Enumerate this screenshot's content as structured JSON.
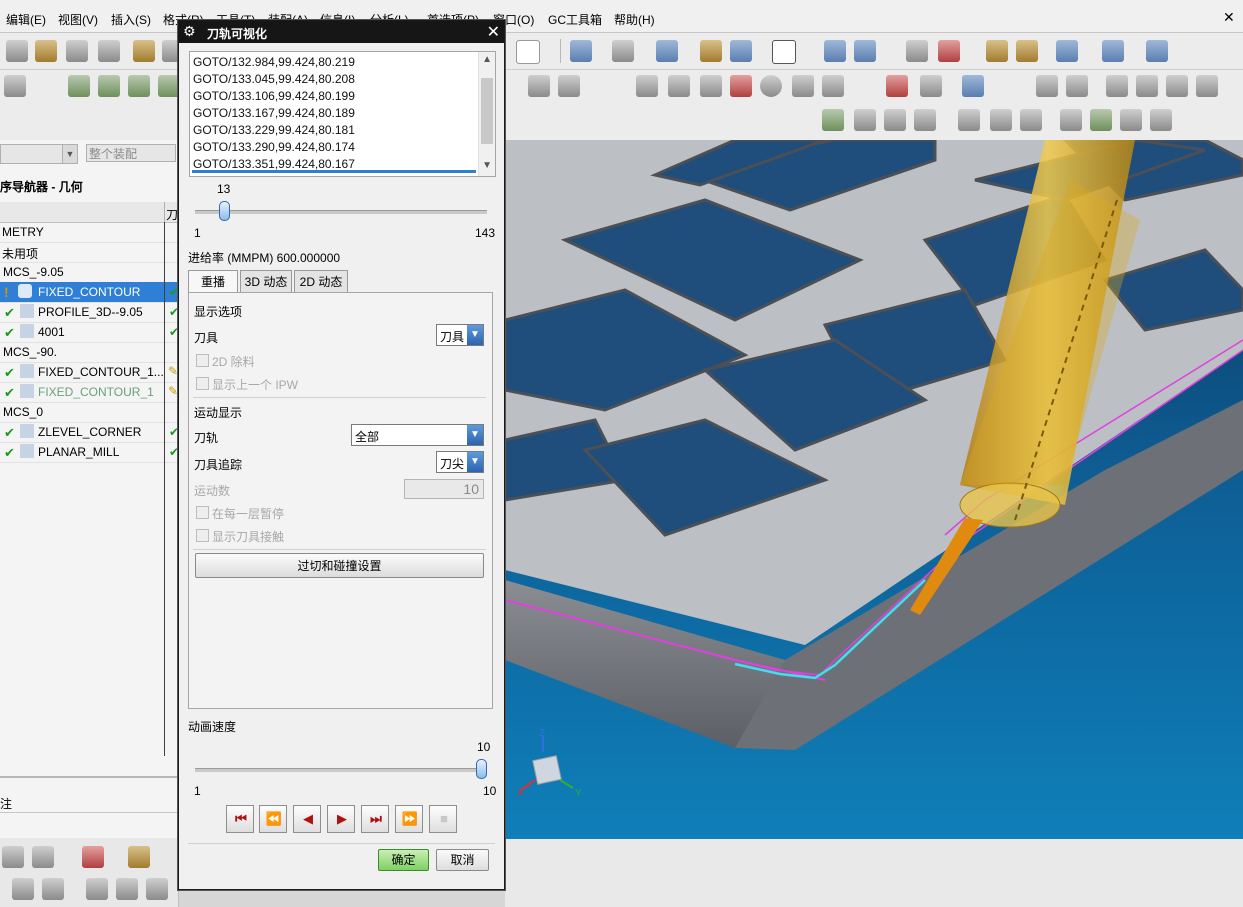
{
  "menubar": {
    "items": [
      "编辑(E)",
      "视图(V)",
      "插入(S)",
      "格式(R)",
      "工具(T)",
      "装配(A)",
      "信息(I)",
      "分析(L)",
      "首选项(P)",
      "窗口(O)",
      "GC工具箱",
      "帮助(H)"
    ]
  },
  "toolbar": {
    "filter_value": "整个装配"
  },
  "navigator": {
    "title": "序导航器 - 几何",
    "column2_header": "刀",
    "rows": [
      {
        "label": "GEOMETRY",
        "shown": "METRY"
      },
      {
        "label": "未用项"
      },
      {
        "label": "MCS_-9.05"
      },
      {
        "label": "FIXED_CONTOUR"
      },
      {
        "label": "PROFILE_3D--9.05"
      },
      {
        "label": "4001"
      },
      {
        "label": "MCS_-90."
      },
      {
        "label": "FIXED_CONTOUR_1..."
      },
      {
        "label": "FIXED_CONTOUR_1"
      },
      {
        "label": "MCS_0"
      },
      {
        "label": "ZLEVEL_CORNER"
      },
      {
        "label": "PLANAR_MILL"
      }
    ],
    "lower_label": "注"
  },
  "dialog": {
    "title": "刀轨可视化",
    "goto_lines": [
      "GOTO/132.984,99.424,80.219",
      "GOTO/133.045,99.424,80.208",
      "GOTO/133.106,99.424,80.199",
      "GOTO/133.167,99.424,80.189",
      "GOTO/133.229,99.424,80.181",
      "GOTO/133.290,99.424,80.174",
      "GOTO/133.351,99.424,80.167"
    ],
    "position_slider": {
      "value": "13",
      "min": "1",
      "max": "143"
    },
    "feed_rate": "进给率 (MMPM) 600.000000",
    "tabs": [
      "重播",
      "3D 动态",
      "2D 动态"
    ],
    "display_options": {
      "section": "显示选项",
      "tool_label": "刀具",
      "tool_value": "刀具",
      "cb_2d_remove": "2D 除料",
      "cb_prev_ipw": "显示上一个 IPW"
    },
    "motion_display": {
      "section": "运动显示",
      "path_label": "刀轨",
      "path_value": "全部",
      "trace_label": "刀具追踪",
      "trace_value": "刀尖",
      "count_label": "运动数",
      "count_value": "10",
      "cb_pause_layer": "在每一层暂停",
      "cb_show_contact": "显示刀具接触",
      "gouge_button": "过切和碰撞设置"
    },
    "anim_speed": {
      "label": "动画速度",
      "value": "10",
      "min": "1",
      "max": "10"
    },
    "playback": [
      "⏮",
      "⏪",
      "◀",
      "▶",
      "⏭",
      "⏩",
      "■"
    ],
    "ok": "确定",
    "cancel": "取消"
  },
  "colors": {
    "dialog_title_bg": "#161616",
    "selection": "#2f7fd6",
    "viewport_bg": "#0e6ba0",
    "part_gray": "#b9bcc0",
    "tool_yellow": "#d9a91c",
    "toolpath_magenta": "#e040e0",
    "toolpath_cyan": "#3fe0f0"
  }
}
